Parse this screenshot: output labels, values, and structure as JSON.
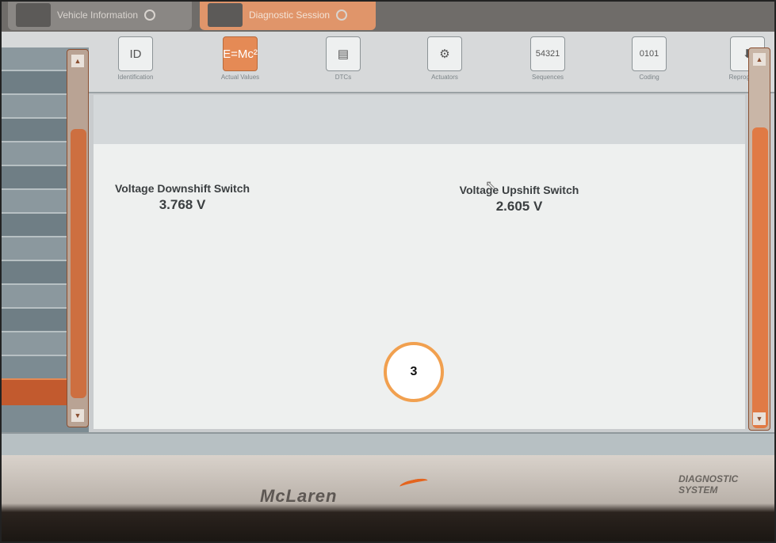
{
  "tabs": [
    {
      "label": "Vehicle Information"
    },
    {
      "label": "Diagnostic Session"
    }
  ],
  "toolbar": {
    "items": [
      {
        "label": "Identification",
        "icon": "id-card-icon",
        "glyph": "ID"
      },
      {
        "label": "Actual Values",
        "icon": "equation-icon",
        "glyph": "E=Mc²",
        "active": true
      },
      {
        "label": "DTCs",
        "icon": "document-car-icon",
        "glyph": "▤"
      },
      {
        "label": "Actuators",
        "icon": "actuator-icon",
        "glyph": "⚙"
      },
      {
        "label": "Sequences",
        "icon": "sequence-numbers-icon",
        "glyph": "54321"
      },
      {
        "label": "Coding",
        "icon": "binary-code-icon",
        "glyph": "0101"
      },
      {
        "label": "Reprogramm",
        "icon": "reprogram-icon",
        "glyph": "⬇"
      }
    ]
  },
  "readings": {
    "downshift": {
      "label": "Voltage Downshift Switch",
      "value": "3.768 V"
    },
    "upshift": {
      "label": "Voltage Upshift Switch",
      "value": "2.605 V"
    }
  },
  "step_marker": "3",
  "bezel": {
    "brand": "McLaren",
    "product_line1": "DIAGNOSTIC",
    "product_line2": "SYSTEM"
  },
  "colors": {
    "accent": "#e58a55",
    "marker": "#f1a04f",
    "logo_swoosh": "#e4641e"
  }
}
